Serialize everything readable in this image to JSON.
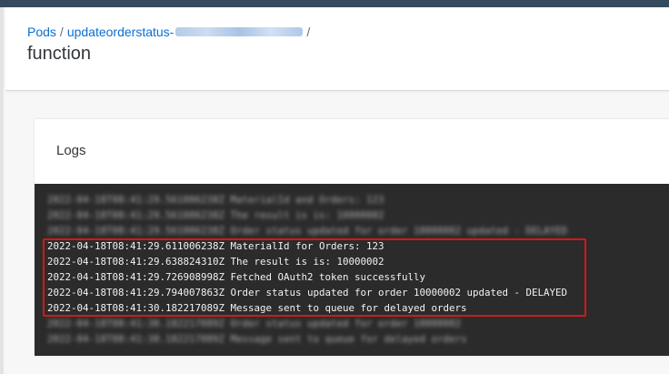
{
  "breadcrumb": {
    "root": "Pods",
    "separator": "/",
    "pod_prefix": "updateorderstatus-"
  },
  "page": {
    "title": "function"
  },
  "logs_card": {
    "title": "Logs"
  },
  "log_lines": [
    {
      "text": "2022-04-18T08:41:29.561006238Z MaterialId and Orders: 123",
      "redacted": true
    },
    {
      "text": "2022-04-18T08:41:29.561006238Z The result is is: 10000002",
      "redacted": true
    },
    {
      "text": "2022-04-18T08:41:29.561006238Z Order status updated for order 10000002 updated - DELAYED",
      "redacted": true
    },
    {
      "text": "2022-04-18T08:41:29.611006238Z MaterialId for Orders: 123",
      "redacted": false
    },
    {
      "text": "2022-04-18T08:41:29.638824310Z The result is is: 10000002",
      "redacted": false
    },
    {
      "text": "2022-04-18T08:41:29.726908998Z Fetched OAuth2 token successfully",
      "redacted": false
    },
    {
      "text": "2022-04-18T08:41:29.794007863Z Order status updated for order 10000002 updated - DELAYED",
      "redacted": false
    },
    {
      "text": "2022-04-18T08:41:30.182217089Z Message sent to queue for delayed orders",
      "redacted": false
    },
    {
      "text": "2022-04-18T08:41:30.182217089Z Order status updated for order 10000002",
      "redacted": true
    },
    {
      "text": "2022-04-18T08:41:30.182217089Z Message sent to queue for delayed orders",
      "redacted": true
    }
  ],
  "colors": {
    "topbar": "#354a5f",
    "link": "#0a6ed1",
    "terminal_bg": "#2b2b2b",
    "highlight": "#cc1b1b"
  }
}
